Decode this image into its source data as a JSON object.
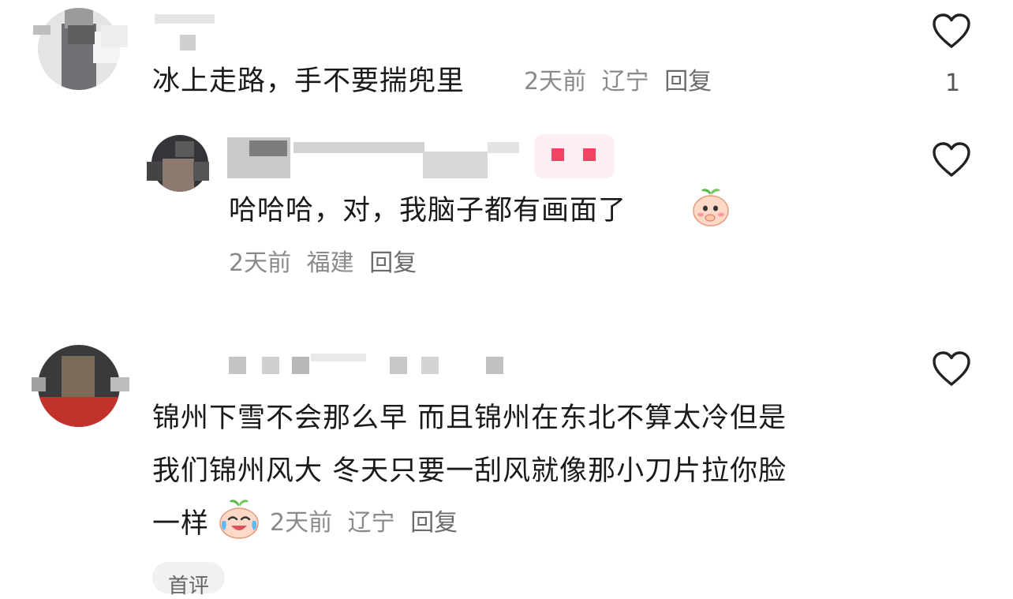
{
  "comments": [
    {
      "text": "冰上走路，手不要揣兜里",
      "time": "2天前",
      "location": "辽宁",
      "reply_label": "回复",
      "likes": "1",
      "icon": "heart-outline-icon"
    },
    {
      "text": "哈哈哈，对，我脑子都有画面了",
      "time": "2天前",
      "location": "福建",
      "reply_label": "回复",
      "emoji": "peach-face-hand-over-mouth",
      "icon": "heart-outline-icon"
    },
    {
      "lines": [
        "锦州下雪不会那么早 而且锦州在东北不算太冷但是",
        "我们锦州风大 冬天只要一刮风就像那小刀片拉你脸",
        "一样"
      ],
      "time": "2天前",
      "location": "辽宁",
      "reply_label": "回复",
      "emoji": "peach-face-crying-laughing",
      "icon": "heart-outline-icon"
    }
  ],
  "chip_label": "首评",
  "colors": {
    "text": "#1a1a1a",
    "meta": "#8a8a8a",
    "heart": "#222222",
    "badge": "#ff4d6d"
  }
}
